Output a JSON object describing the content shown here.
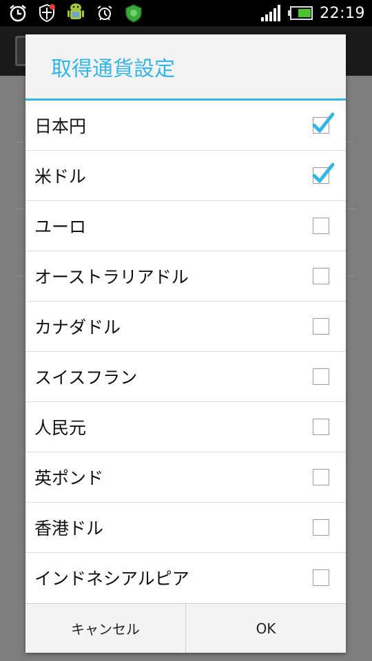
{
  "status_bar": {
    "time": "22:19",
    "icons": [
      "alarm-clock-icon",
      "shield-icon",
      "android-icon",
      "alarm-icon",
      "security-app-icon",
      "signal-icon",
      "battery-icon"
    ]
  },
  "dialog": {
    "title": "取得通貨設定",
    "accent_color": "#33b5e5",
    "items": [
      {
        "label": "日本円",
        "checked": true
      },
      {
        "label": "米ドル",
        "checked": true
      },
      {
        "label": "ユーロ",
        "checked": false
      },
      {
        "label": "オーストラリアドル",
        "checked": false
      },
      {
        "label": "カナダドル",
        "checked": false
      },
      {
        "label": "スイスフラン",
        "checked": false
      },
      {
        "label": "人民元",
        "checked": false
      },
      {
        "label": "英ポンド",
        "checked": false
      },
      {
        "label": "香港ドル",
        "checked": false
      },
      {
        "label": "インドネシアルピア",
        "checked": false
      }
    ],
    "buttons": {
      "cancel": "キャンセル",
      "ok": "OK"
    }
  }
}
